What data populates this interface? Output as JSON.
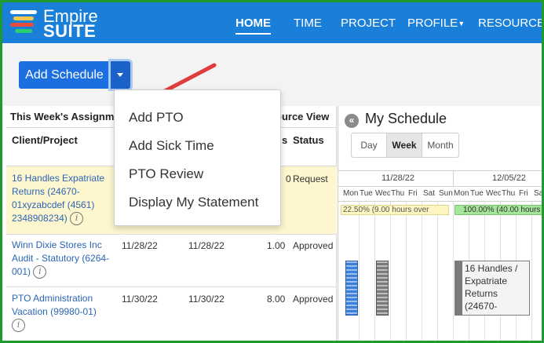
{
  "app": {
    "logo_line1": "Empire",
    "logo_line2": "SUITE",
    "logo_colors": [
      "#ffffff",
      "#f2c94c",
      "#e74c3c",
      "#2ecc71"
    ]
  },
  "nav": {
    "items": [
      {
        "label": "HOME",
        "active": true
      },
      {
        "label": "TIME",
        "active": false
      },
      {
        "label": "PROJECT",
        "active": false
      },
      {
        "label": "PROFILE",
        "active": false,
        "has_caret": true
      },
      {
        "label": "RESOURCE",
        "active": false
      }
    ]
  },
  "toolbar": {
    "add_schedule_label": "Add Schedule",
    "dropdown_icon": "caret-down-icon"
  },
  "dropdown_menu": {
    "items": [
      "Add PTO",
      "Add Sick Time",
      "PTO Review",
      "Display My Statement"
    ]
  },
  "assignments": {
    "title": "This Week's Assignm",
    "title_right": "ource View",
    "columns": {
      "client": "Client/Project",
      "hours": "s",
      "status": "Status"
    },
    "rows": [
      {
        "client_lines": [
          "16 Handles Expatriate",
          "Returns (24670-",
          "01xyzabcdef (4561)",
          "2348908234)"
        ],
        "start": "",
        "end": "",
        "hours": "0",
        "status": "Request",
        "highlight": true
      },
      {
        "client_lines": [
          "Winn Dixie Stores Inc",
          "Audit - Statutory (6264-",
          "001)"
        ],
        "start": "11/28/22",
        "end": "11/28/22",
        "hours": "1.00",
        "status": "Approved",
        "highlight": false
      },
      {
        "client_lines": [
          "PTO Administration",
          "Vacation (99980-01)"
        ],
        "start": "11/30/22",
        "end": "11/30/22",
        "hours": "8.00",
        "status": "Approved",
        "highlight": false
      }
    ]
  },
  "schedule": {
    "title": "My Schedule",
    "views": [
      "Day",
      "Week",
      "Month"
    ],
    "active_view": "Week",
    "weeks": [
      "11/28/22",
      "12/05/22"
    ],
    "days": [
      "Mon",
      "Tue",
      "Wed",
      "Thu",
      "Fri",
      "Sat",
      "Sun",
      "Mon",
      "Tue",
      "Wed",
      "Thu",
      "Fri",
      "Sat"
    ],
    "week1_summary": "22.50% (9.00 hours over",
    "week2_summary": "100.00% (40.00 hours",
    "detail_block_lines": [
      "16 Handles /",
      "Expatriate",
      "Returns",
      "(24670-"
    ]
  }
}
